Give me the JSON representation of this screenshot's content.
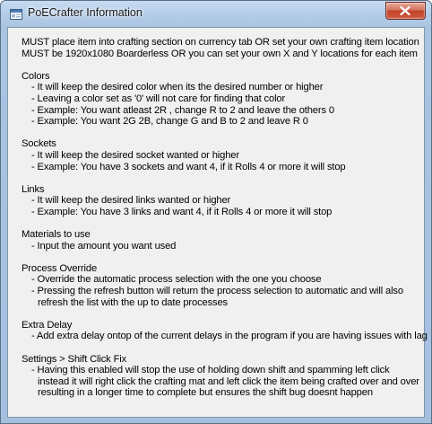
{
  "window": {
    "title": "PoECrafter Information"
  },
  "content": {
    "intro": [
      "MUST place item into crafting section on currency tab OR set your own crafting item location",
      "MUST be 1920x1080 Boarderless OR you can set your own X and Y locations for each item"
    ],
    "colors": {
      "heading": "Colors",
      "lines": [
        "- It will keep the desired color when its the desired number or higher",
        "- Leaving a color set as '0' will not care for finding that color",
        "- Example: You want atleast 2R , change R to 2 and leave the others 0",
        "- Example: You want 2G 2B, change G and B to 2 and leave R 0"
      ]
    },
    "sockets": {
      "heading": "Sockets",
      "lines": [
        "- It will keep the desired socket wanted or higher",
        "- Example: You have 3 sockets and want 4, if it Rolls 4 or more it will stop"
      ]
    },
    "links": {
      "heading": "Links",
      "lines": [
        "- It will keep the desired links wanted or higher",
        "- Example: You have 3 links and want 4, if it Rolls 4 or more it will stop"
      ]
    },
    "materials": {
      "heading": "Materials to use",
      "lines": [
        "- Input the amount you want used"
      ]
    },
    "process_override": {
      "heading": "Process Override",
      "lines": [
        "- Override the automatic process selection with the one you choose",
        "- Pressing the refresh button will return the process selection to automatic and will also",
        "refresh the list with the up to date processes"
      ]
    },
    "extra_delay": {
      "heading": "Extra Delay",
      "lines": [
        "- Add extra delay ontop of the current delays in the program if you are having issues with lag"
      ]
    },
    "shift_click": {
      "heading": "Settings > Shift Click Fix",
      "lines": [
        "- Having this enabled will stop the use of holding down shift and spamming left click",
        "instead it will right click the crafting mat and left click the item being crafted over and over",
        "resulting in a longer time to complete but ensures the shift bug doesnt happen"
      ]
    }
  }
}
